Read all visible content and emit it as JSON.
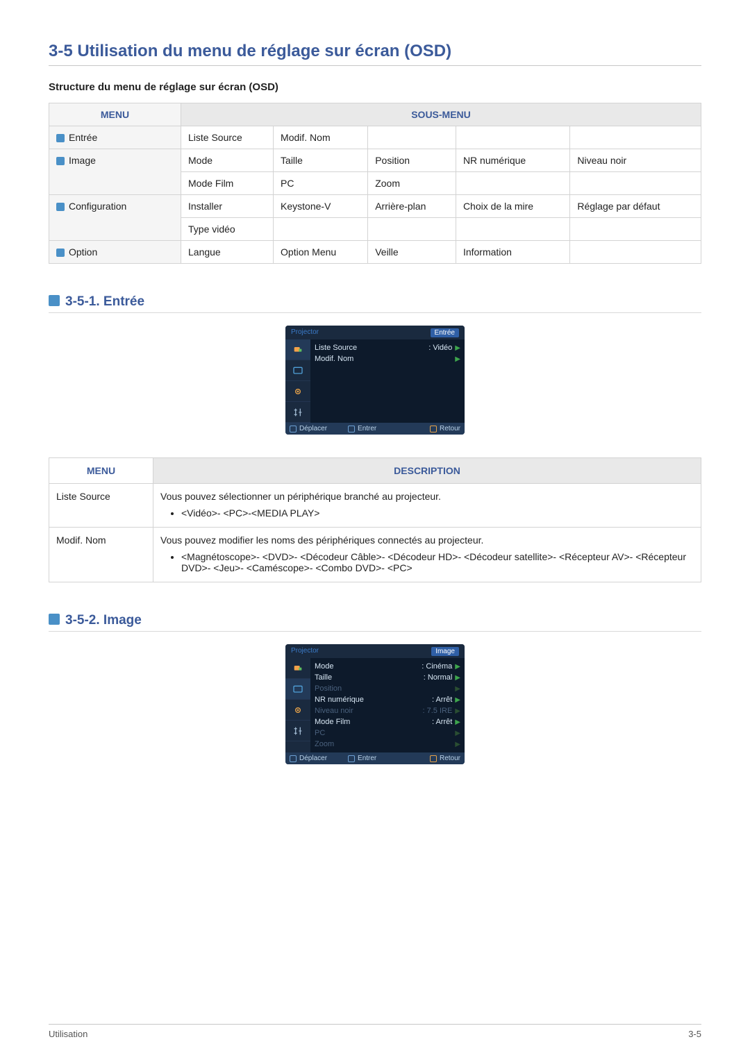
{
  "page": {
    "title": "3-5   Utilisation du menu de réglage sur écran (OSD)",
    "subtitle": "Structure du menu de réglage sur écran (OSD)"
  },
  "structure_table": {
    "head_menu": "MENU",
    "head_sub": "SOUS-MENU",
    "rows": {
      "entree": {
        "label": "Entrée",
        "c1": "Liste Source",
        "c2": "Modif. Nom",
        "c3": "",
        "c4": "",
        "c5": ""
      },
      "image1": {
        "label": "Image",
        "c1": "Mode",
        "c2": "Taille",
        "c3": "Position",
        "c4": "NR numérique",
        "c5": "Niveau noir"
      },
      "image2": {
        "c1": "Mode Film",
        "c2": "PC",
        "c3": "Zoom",
        "c4": "",
        "c5": ""
      },
      "config1": {
        "label": "Configuration",
        "c1": "Installer",
        "c2": "Keystone-V",
        "c3": "Arrière-plan",
        "c4": "Choix de la mire",
        "c5": "Réglage par défaut"
      },
      "config2": {
        "c1": "Type vidéo",
        "c2": "",
        "c3": "",
        "c4": "",
        "c5": ""
      },
      "option": {
        "label": "Option",
        "c1": "Langue",
        "c2": "Option Menu",
        "c3": "Veille",
        "c4": "Information",
        "c5": ""
      }
    }
  },
  "sec1": {
    "head": "3-5-1. Entrée",
    "osd": {
      "brand": "Projector",
      "section": "Entrée",
      "items": [
        {
          "label": "Liste Source",
          "value": ": Vidéo"
        },
        {
          "label": "Modif. Nom",
          "value": ""
        }
      ],
      "nav": {
        "move": "Déplacer",
        "enter": "Entrer",
        "back": "Retour"
      }
    },
    "desc_table": {
      "head_menu": "MENU",
      "head_desc": "DESCRIPTION",
      "r1": {
        "menu": "Liste Source",
        "text": "Vous pouvez sélectionner un périphérique branché au projecteur.",
        "bullet": "<Vidéo>- <PC>-<MEDIA PLAY>"
      },
      "r2": {
        "menu": "Modif. Nom",
        "text": "Vous pouvez modifier les noms des périphériques connectés au projecteur.",
        "bullet": "<Magnétoscope>- <DVD>- <Décodeur Câble>- <Décodeur HD>- <Décodeur satellite>- <Récepteur AV>- <Récepteur DVD>- <Jeu>- <Caméscope>- <Combo DVD>- <PC>"
      }
    }
  },
  "sec2": {
    "head": "3-5-2. Image",
    "osd": {
      "brand": "Projector",
      "section": "Image",
      "items": [
        {
          "label": "Mode",
          "value": ": Cinéma",
          "dim": false
        },
        {
          "label": "Taille",
          "value": ": Normal",
          "dim": false
        },
        {
          "label": "Position",
          "value": "",
          "dim": true
        },
        {
          "label": "NR numérique",
          "value": ": Arrêt",
          "dim": false
        },
        {
          "label": "Niveau noir",
          "value": ": 7.5 IRE",
          "dim": true
        },
        {
          "label": "Mode Film",
          "value": ": Arrêt",
          "dim": false
        },
        {
          "label": "PC",
          "value": "",
          "dim": true
        },
        {
          "label": "Zoom",
          "value": "",
          "dim": true
        }
      ],
      "nav": {
        "move": "Déplacer",
        "enter": "Entrer",
        "back": "Retour"
      }
    }
  },
  "footer": {
    "left": "Utilisation",
    "right": "3-5"
  }
}
